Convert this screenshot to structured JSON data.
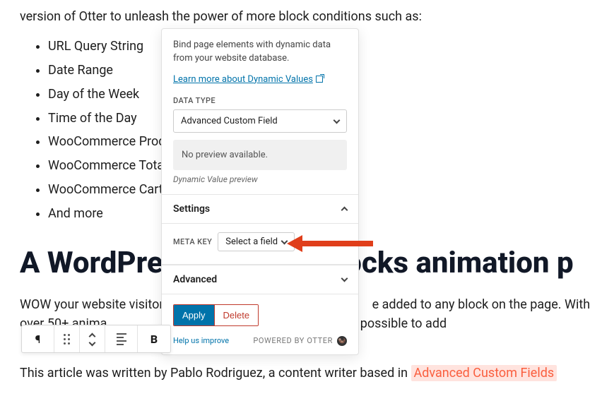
{
  "content": {
    "intro_tail": "version of Otter to unleash the power of more block conditions such as:",
    "features": [
      "URL Query String",
      "Date Range",
      "Day of the Week",
      "Time of the Day",
      "WooCommerce Produ",
      "WooCommerce Total",
      "WooCommerce Cart",
      "And more"
    ],
    "heading_part1": "A WordPres",
    "heading_part2": "ocks animation p",
    "para2_a": "WOW your website visitors",
    "para2_b": "e added to any block on the page. With over 50+ anima",
    "para2_c": "makes it possible to add",
    "para3_a": "This article was written by Pablo Rodriguez, a content writer based in ",
    "highlight": "Advanced Custom Fields"
  },
  "panel": {
    "description": "Bind page elements with dynamic data from your website database.",
    "learn_more": "Learn more about Dynamic Values",
    "data_type_label": "DATA TYPE",
    "data_type_value": "Advanced Custom Field",
    "preview_text": "No preview available.",
    "preview_caption": "Dynamic Value preview",
    "settings_title": "Settings",
    "meta_key_label": "META KEY",
    "meta_key_value": "Select a field",
    "advanced_title": "Advanced",
    "apply_label": "Apply",
    "delete_label": "Delete",
    "help_label": "Help us improve",
    "powered_label": "POWERED BY OTTER"
  },
  "toolbar": {
    "pilcrow": "¶",
    "bold": "B"
  }
}
